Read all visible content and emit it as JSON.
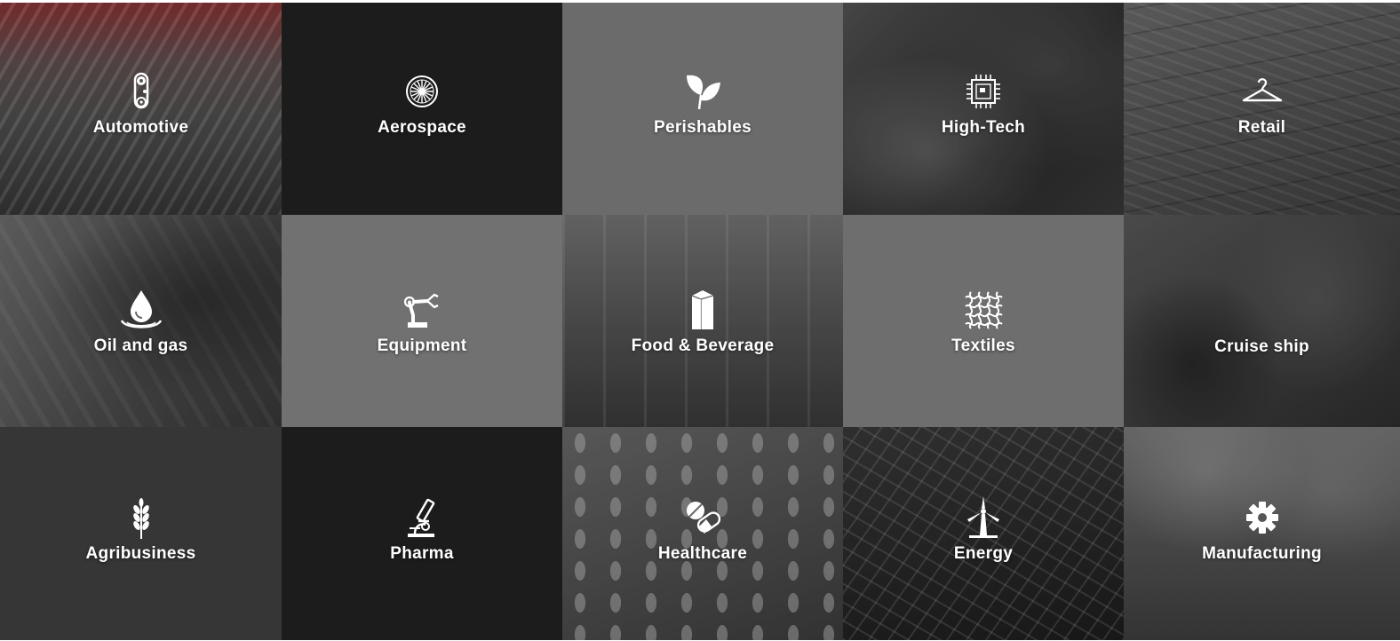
{
  "industries": [
    {
      "label": "Automotive",
      "icon": "gear-chain-icon"
    },
    {
      "label": "Aerospace",
      "icon": "jet-engine-icon"
    },
    {
      "label": "Perishables",
      "icon": "leaf-icon"
    },
    {
      "label": "High-Tech",
      "icon": "microchip-icon"
    },
    {
      "label": "Retail",
      "icon": "hanger-icon"
    },
    {
      "label": "Oil and gas",
      "icon": "oil-drop-icon"
    },
    {
      "label": "Equipment",
      "icon": "robot-arm-icon"
    },
    {
      "label": "Food & Beverage",
      "icon": "milk-carton-icon"
    },
    {
      "label": "Textiles",
      "icon": "woven-fabric-icon"
    },
    {
      "label": "Cruise ship",
      "icon": ""
    },
    {
      "label": "Agribusiness",
      "icon": "wheat-icon"
    },
    {
      "label": "Pharma",
      "icon": "microscope-icon"
    },
    {
      "label": "Healthcare",
      "icon": "capsule-pill-icon"
    },
    {
      "label": "Energy",
      "icon": "wind-turbine-icon"
    },
    {
      "label": "Manufacturing",
      "icon": "gear-icon"
    }
  ],
  "colors": {
    "tile_dark": "#1c1c1c",
    "tile_grey": "#6b6b6b",
    "tile_charcoal": "#363636",
    "automotive_tint": "#9a3b3d",
    "text": "#ffffff"
  }
}
